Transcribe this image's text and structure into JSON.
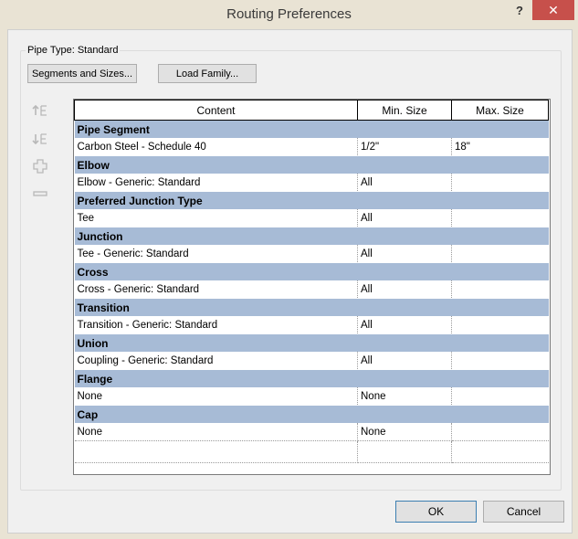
{
  "window": {
    "title": "Routing Preferences",
    "help_label": "?",
    "close_label": "✕"
  },
  "pipe_type_label": "Pipe Type: Standard",
  "buttons": {
    "segments_and_sizes": "Segments and Sizes...",
    "load_family": "Load Family...",
    "ok": "OK",
    "cancel": "Cancel"
  },
  "side_icons": [
    "move-up-icon",
    "move-down-icon",
    "add-row-icon",
    "remove-row-icon"
  ],
  "table": {
    "headers": [
      "Content",
      "Min. Size",
      "Max. Size"
    ],
    "groups": [
      {
        "name": "Pipe Segment",
        "rows": [
          [
            "Carbon Steel - Schedule 40",
            "1/2\"",
            "18\""
          ]
        ]
      },
      {
        "name": "Elbow",
        "rows": [
          [
            "Elbow - Generic: Standard",
            "All",
            ""
          ]
        ]
      },
      {
        "name": "Preferred Junction Type",
        "rows": [
          [
            "Tee",
            "All",
            ""
          ]
        ]
      },
      {
        "name": "Junction",
        "rows": [
          [
            "Tee - Generic: Standard",
            "All",
            ""
          ]
        ]
      },
      {
        "name": "Cross",
        "rows": [
          [
            "Cross - Generic: Standard",
            "All",
            ""
          ]
        ]
      },
      {
        "name": "Transition",
        "rows": [
          [
            "Transition - Generic: Standard",
            "All",
            ""
          ]
        ]
      },
      {
        "name": "Union",
        "rows": [
          [
            "Coupling - Generic: Standard",
            "All",
            ""
          ]
        ]
      },
      {
        "name": "Flange",
        "rows": [
          [
            "None",
            "None",
            ""
          ]
        ]
      },
      {
        "name": "Cap",
        "rows": [
          [
            "None",
            "None",
            ""
          ]
        ]
      }
    ]
  },
  "colors": {
    "group_header_bg": "#a7bbd6",
    "close_button_bg": "#c7504b",
    "ok_button_border": "#3c7fb1"
  }
}
